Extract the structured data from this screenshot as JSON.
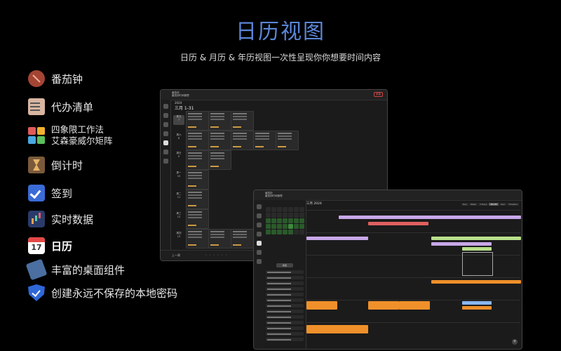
{
  "header": {
    "title": "日历视图",
    "subtitle": "日历 & 月历 & 年历视图一次性呈现你你想要时间内容"
  },
  "features": [
    {
      "label": "番茄钟",
      "icon": "tomato-icon"
    },
    {
      "label": "代办清单",
      "icon": "todo-list-icon"
    },
    {
      "label_line1": "四象限工作法",
      "label_line2": "艾森豪威尔矩阵",
      "icon": "eisenhower-grid-icon"
    },
    {
      "label": "倒计时",
      "icon": "hourglass-icon"
    },
    {
      "label": "签到",
      "icon": "checkin-icon"
    },
    {
      "label": "实时数据",
      "icon": "statistics-icon"
    },
    {
      "label": "日历",
      "icon": "calendar-icon",
      "active": true,
      "icon_day": "17"
    },
    {
      "label": "丰富的桌面组件",
      "icon": "widget-icon"
    },
    {
      "label": "创建永远不保存的本地密码",
      "icon": "shield-icon"
    }
  ],
  "week_window": {
    "app_name": "番茄钟",
    "app_sub": "番茄钟时间管理",
    "year": "2024",
    "range": "三月 1-31",
    "days": [
      {
        "name": "周五",
        "num": "7"
      },
      {
        "name": "周六",
        "num": "8"
      },
      {
        "name": "周日",
        "num": "9"
      },
      {
        "name": "周一",
        "num": "10"
      },
      {
        "name": "周二",
        "num": "11"
      },
      {
        "name": "周三",
        "num": "12"
      },
      {
        "name": "周四",
        "num": "13"
      }
    ],
    "footer": "上一周",
    "button": "新建"
  },
  "month_window": {
    "app_name": "番茄钟",
    "app_sub": "番茄钟时间管理",
    "title": "三月 2024",
    "views": [
      "Day",
      "Week",
      "3 Days",
      "Month",
      "Year",
      "Timeline"
    ],
    "active_view": "Month",
    "add_label": "添加",
    "new_label": "新建"
  },
  "colors": {
    "accent": "#5b86d8",
    "purple": "#c8a8e8",
    "green": "#b8e08a",
    "orange": "#f0902a",
    "red": "#e06060",
    "blue": "#8ab8f0"
  }
}
